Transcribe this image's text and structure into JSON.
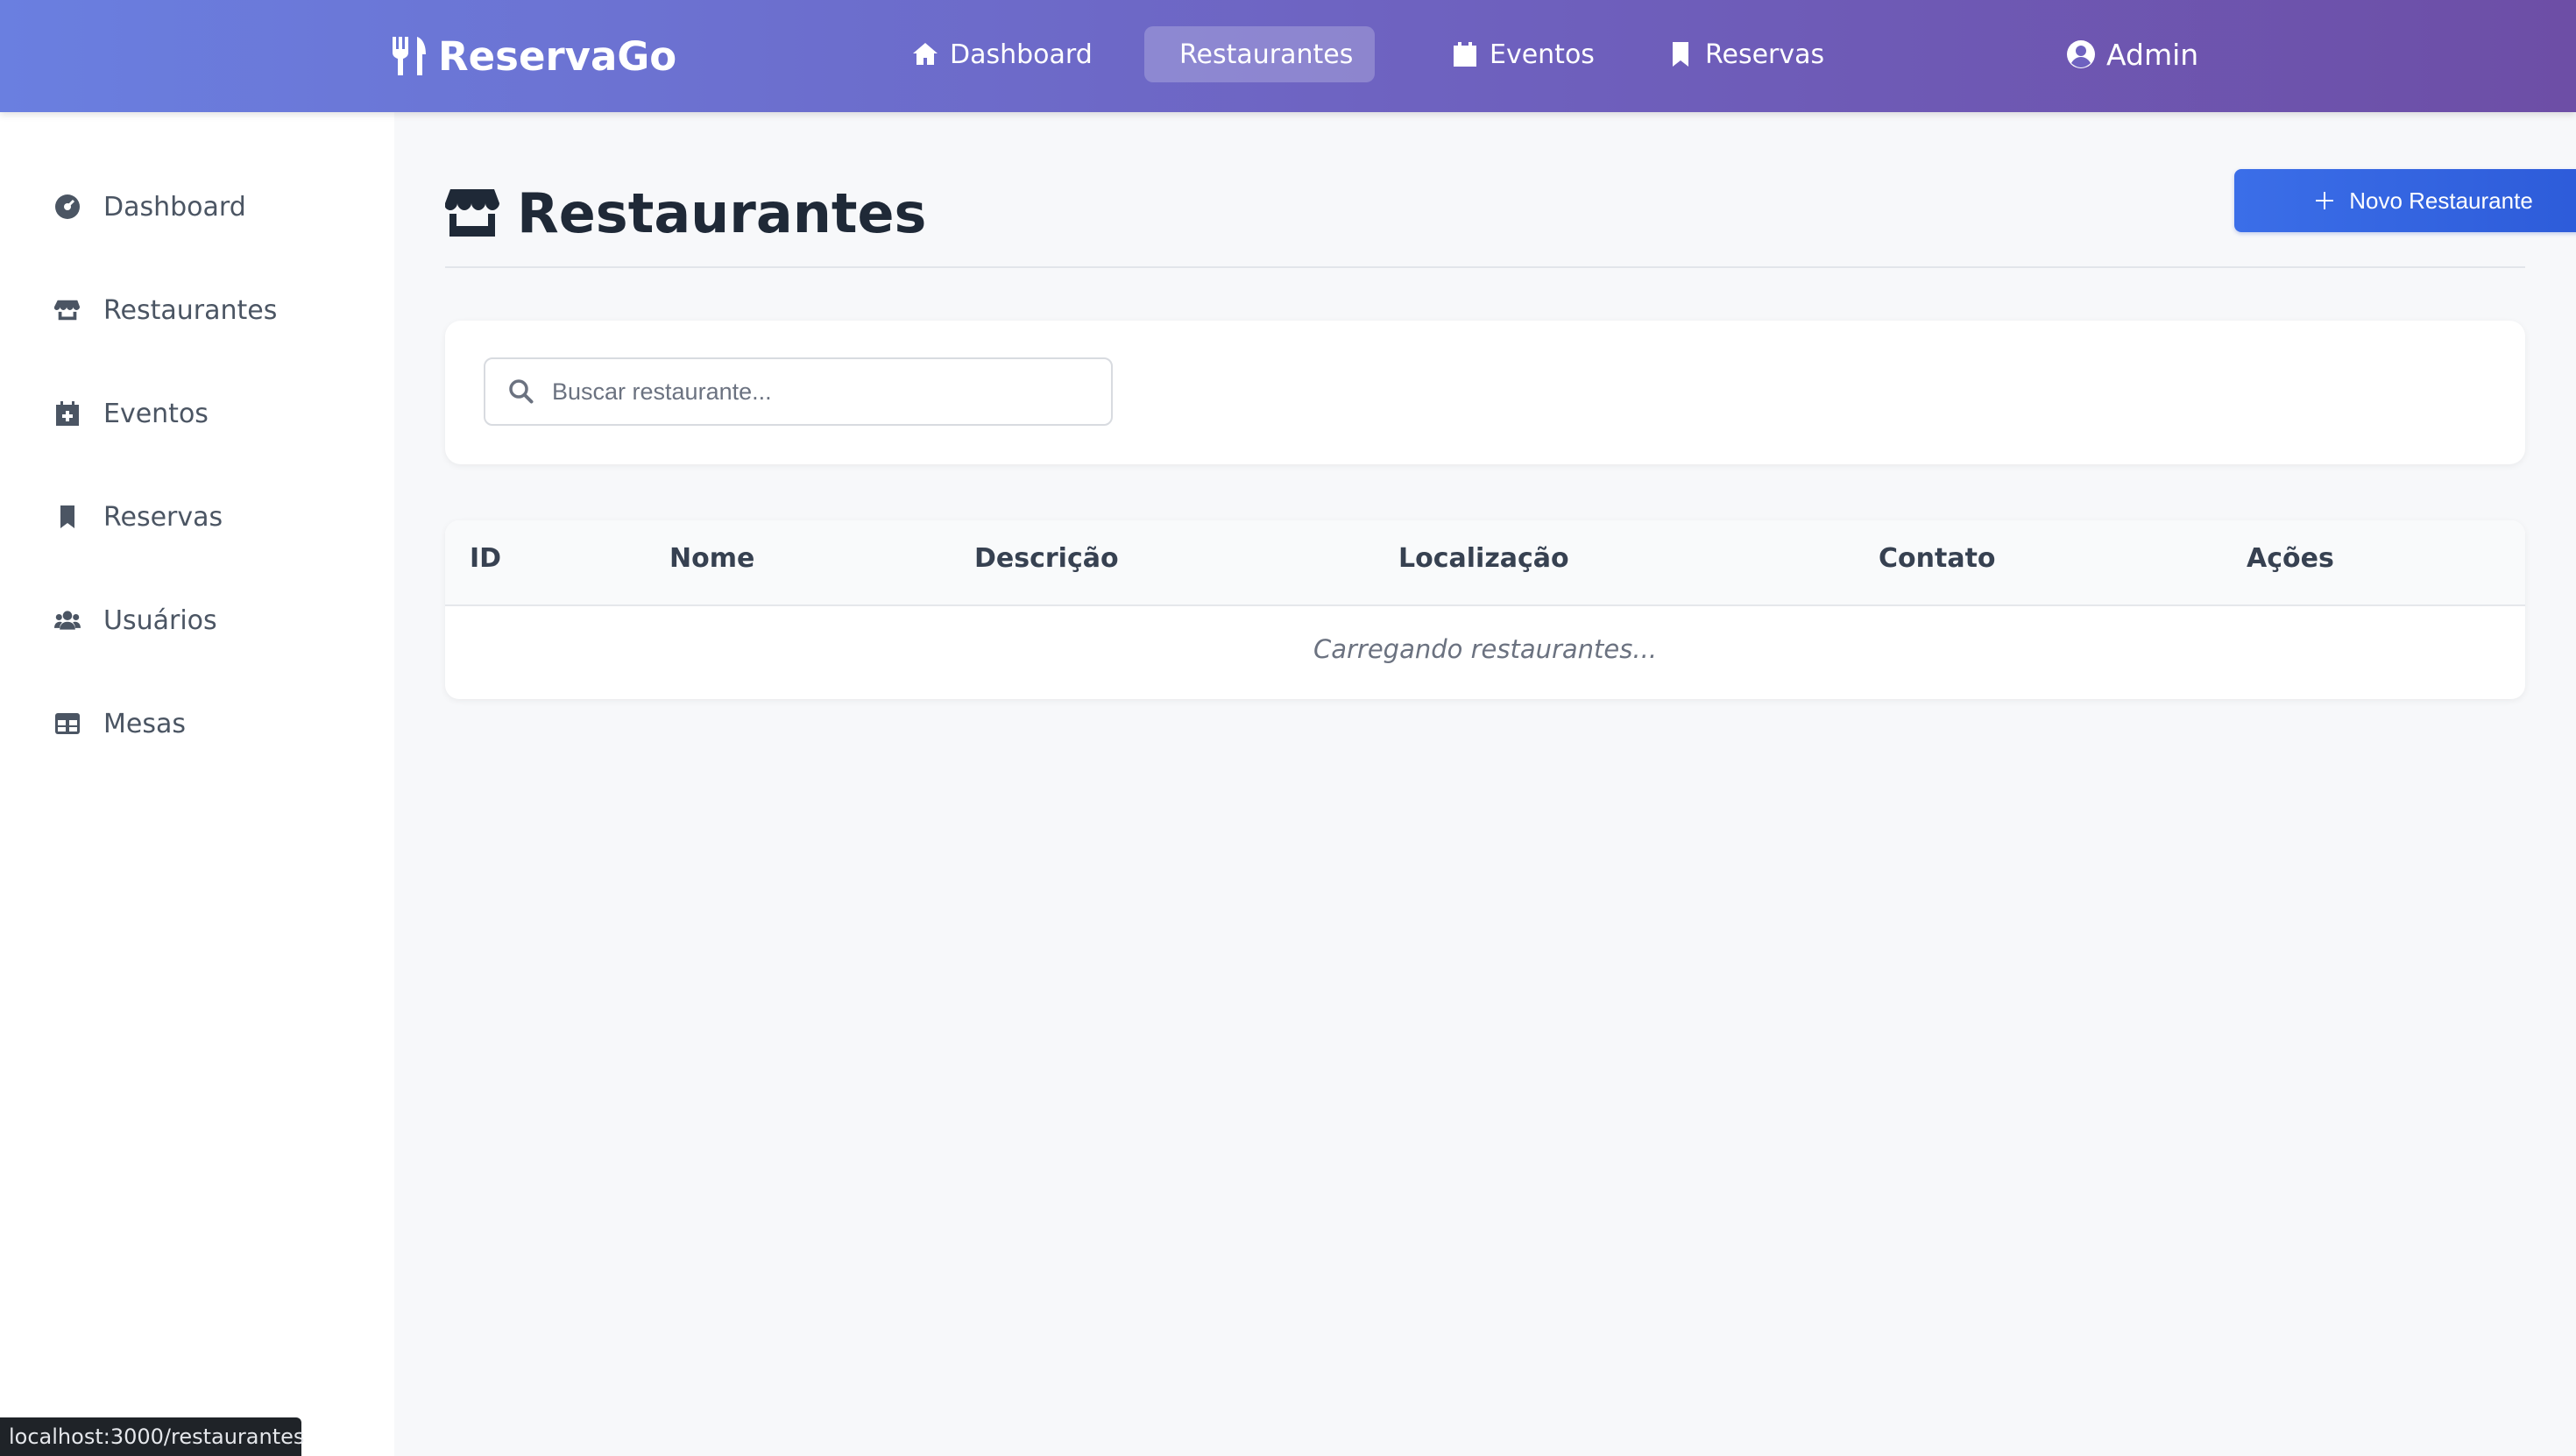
{
  "brand": {
    "name": "ReservaGo",
    "icon": "utensils-icon"
  },
  "topnav": {
    "items": [
      {
        "label": "Dashboard",
        "icon": "home-icon",
        "active": false
      },
      {
        "label": "Restaurantes",
        "icon": "store-icon",
        "active": true
      },
      {
        "label": "Eventos",
        "icon": "calendar-icon",
        "active": false
      },
      {
        "label": "Reservas",
        "icon": "bookmark-icon",
        "active": false
      }
    ],
    "user": {
      "label": "Admin",
      "icon": "user-circle-icon"
    }
  },
  "sidebar": {
    "items": [
      {
        "label": "Dashboard",
        "icon": "gauge-icon"
      },
      {
        "label": "Restaurantes",
        "icon": "store-icon"
      },
      {
        "label": "Eventos",
        "icon": "calendar-plus-icon"
      },
      {
        "label": "Reservas",
        "icon": "bookmark-icon"
      },
      {
        "label": "Usuários",
        "icon": "users-icon"
      },
      {
        "label": "Mesas",
        "icon": "table-icon"
      }
    ]
  },
  "page": {
    "title": "Restaurantes",
    "new_button_label": "Novo Restaurante"
  },
  "search": {
    "placeholder": "Buscar restaurante...",
    "value": ""
  },
  "table": {
    "columns": [
      "ID",
      "Nome",
      "Descrição",
      "Localização",
      "Contato",
      "Ações"
    ],
    "loading_text": "Carregando restaurantes..."
  },
  "status_bar": {
    "url": "localhost:3000/restaurantes"
  },
  "colors": {
    "nav_gradient_start": "#6a7fe0",
    "nav_gradient_end": "#6d4ea6",
    "primary_button": "#3b6ee8",
    "background": "#f7f8fa"
  }
}
